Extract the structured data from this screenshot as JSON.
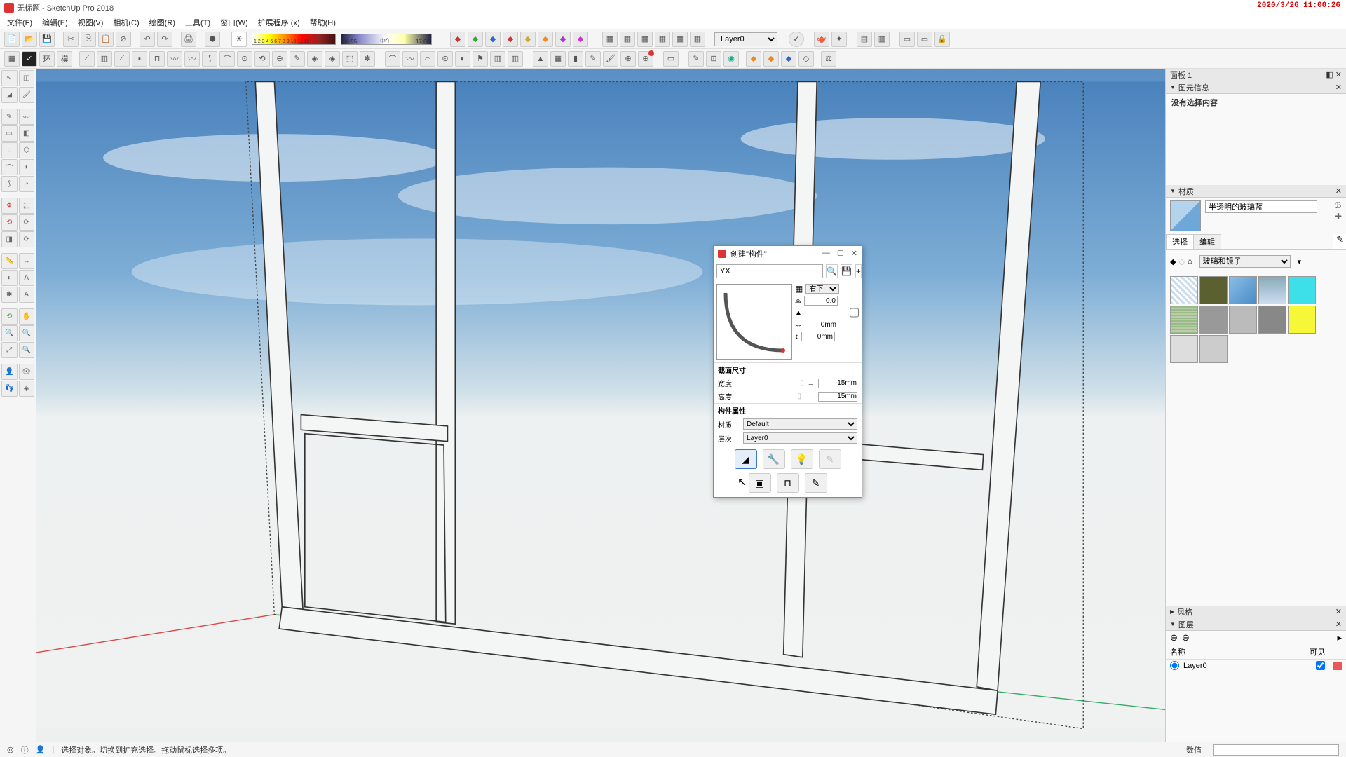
{
  "app": {
    "title": "无标题 - SketchUp Pro 2018",
    "timestamp": "2020/3/26 11:00:26"
  },
  "menu": [
    "文件(F)",
    "编辑(E)",
    "视图(V)",
    "相机(C)",
    "绘图(R)",
    "工具(T)",
    "窗口(W)",
    "扩展程序 (x)",
    "帮助(H)"
  ],
  "gradient_labels": "1 2 3 4 5 6 7 8 9 10 11 12",
  "time_labels": {
    "a": "06:55",
    "b": "中午",
    "c": "17:00"
  },
  "layer_dropdown": "Layer0",
  "panels": {
    "panel1": "面板 1",
    "entity": "图元信息",
    "entity_content": "没有选择内容",
    "materials": "材质",
    "mat_name": "半透明的玻璃蓝",
    "select_tab": "选择",
    "edit_tab": "编辑",
    "mat_category": "玻璃和镜子",
    "styles": "风格",
    "layers": "图层",
    "layer_name_h": "名称",
    "layer_vis_h": "可见",
    "layer0": "Layer0"
  },
  "dialog": {
    "title": "创建\"构件\"",
    "search_value": "YX",
    "align_dropdown": "右下",
    "angle_value": "0.0",
    "mirror_check": "",
    "dim1": "0mm",
    "dim2": "0mm",
    "sec_size": "截面尺寸",
    "width_l": "宽度",
    "width_v": "15mm",
    "height_l": "高度",
    "height_v": "15mm",
    "sec_attr": "构件属性",
    "mat_l": "材质",
    "mat_v": "Default",
    "lay_l": "层次",
    "lay_v": "Layer0"
  },
  "status": {
    "hint": "选择对象。切换到扩充选择。拖动鼠标选择多项。",
    "value_label": "数值"
  }
}
